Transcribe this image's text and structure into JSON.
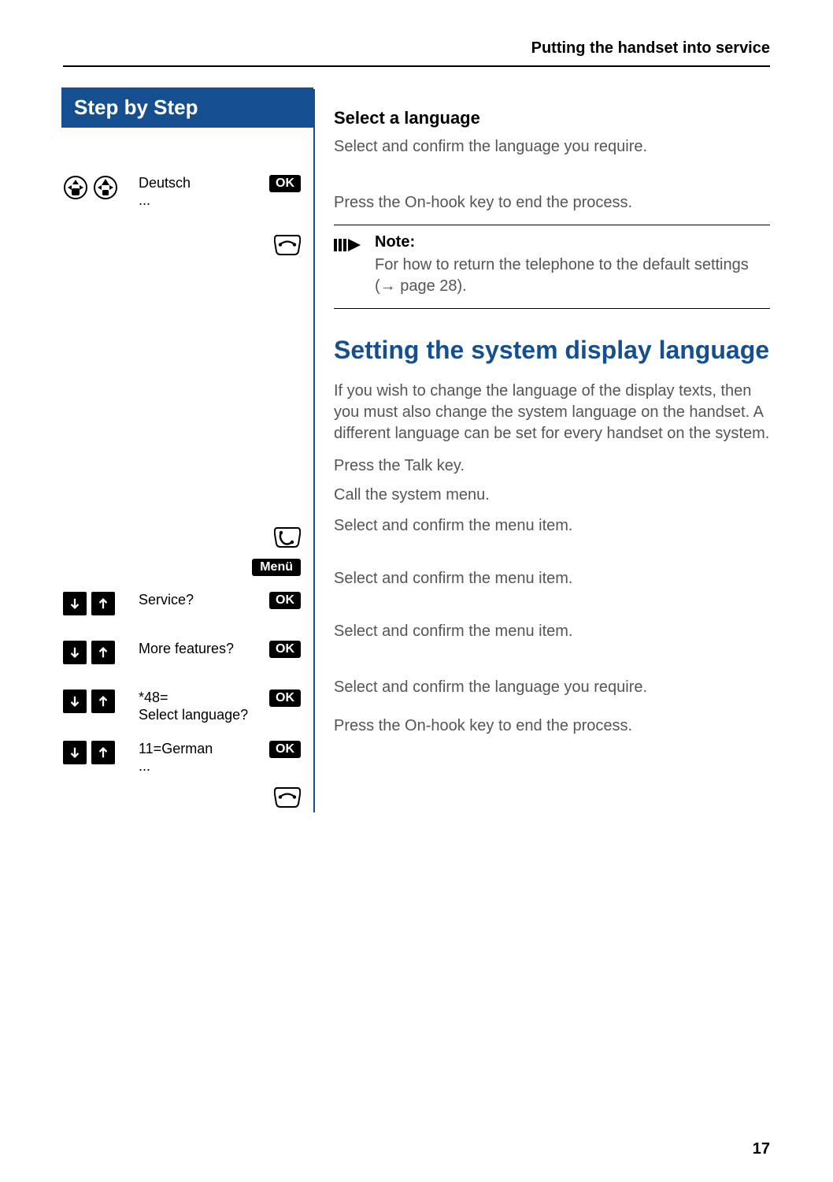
{
  "header": {
    "title": "Putting the handset into service"
  },
  "sidebar": {
    "banner": "Step by Step",
    "rows": [
      {
        "icons": "nav-nav",
        "text_lines": [
          "Deutsch",
          "..."
        ],
        "button": "OK"
      },
      {
        "icons": "",
        "text_lines": [],
        "button": "onhook"
      },
      {
        "icons": "",
        "text_lines": [],
        "button": "talk"
      },
      {
        "icons": "",
        "text_lines": [],
        "button": "Menü"
      },
      {
        "icons": "arrows",
        "text_lines": [
          "Service?"
        ],
        "button": "OK"
      },
      {
        "icons": "arrows",
        "text_lines": [
          "More features?"
        ],
        "button": "OK"
      },
      {
        "icons": "arrows",
        "text_lines": [
          "*48=",
          "Select language?"
        ],
        "button": "OK"
      },
      {
        "icons": "arrows",
        "text_lines": [
          "11=German",
          "..."
        ],
        "button": "OK"
      },
      {
        "icons": "",
        "text_lines": [],
        "button": "onhook"
      }
    ]
  },
  "content": {
    "section1_title": "Select a language",
    "line1": "Select and confirm the language you require.",
    "line2": "Press the On-hook key to end the process.",
    "note_title": "Note:",
    "note_body_1": "For how to return the telephone to the default settings (",
    "note_body_2": " page 28).",
    "section2_title": "Setting the system display language",
    "para2": "If you wish to change the language of the display texts, then you must also change the system language on the handset. A different language can be set for every handset on the system.",
    "line3": "Press the Talk key.",
    "line4": "Call the system menu.",
    "line5": "Select and confirm the menu item.",
    "line6": "Select and confirm the menu item.",
    "line7": "Select and confirm the menu item.",
    "line8": "Select and confirm the language you require.",
    "line9": "Press the On-hook key to end the process."
  },
  "buttons": {
    "ok": "OK",
    "menu": "Menü"
  },
  "page_number": "17"
}
